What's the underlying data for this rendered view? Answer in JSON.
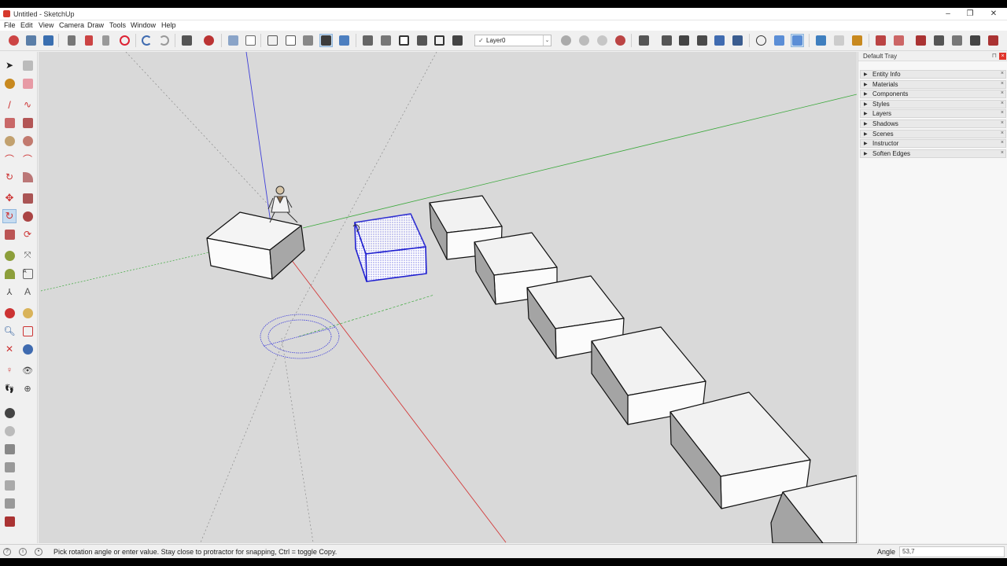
{
  "window": {
    "title": "Untitled - SketchUp"
  },
  "menu": [
    "File",
    "Edit",
    "View",
    "Camera",
    "Draw",
    "Tools",
    "Window",
    "Help"
  ],
  "toolbar": {
    "layer_selected": "Layer0"
  },
  "tray": {
    "title": "Default Tray",
    "panels": [
      "Entity Info",
      "Materials",
      "Components",
      "Styles",
      "Layers",
      "Shadows",
      "Scenes",
      "Instructor",
      "Soften Edges"
    ]
  },
  "status": {
    "message": "Pick rotation angle or enter value.  Stay close to protractor for snapping, Ctrl = toggle Copy.",
    "vcb_label": "Angle",
    "vcb_value": "53,7"
  },
  "colors": {
    "viewport_bg": "#d9d9d9",
    "selection": "#1f1fd0",
    "axis_red": "#d23b3b",
    "axis_green": "#3aa83a",
    "axis_blue": "#3f3fd9"
  },
  "icons": {
    "tray_close": "×",
    "panel_close": "×",
    "panel_expand": "▶"
  }
}
